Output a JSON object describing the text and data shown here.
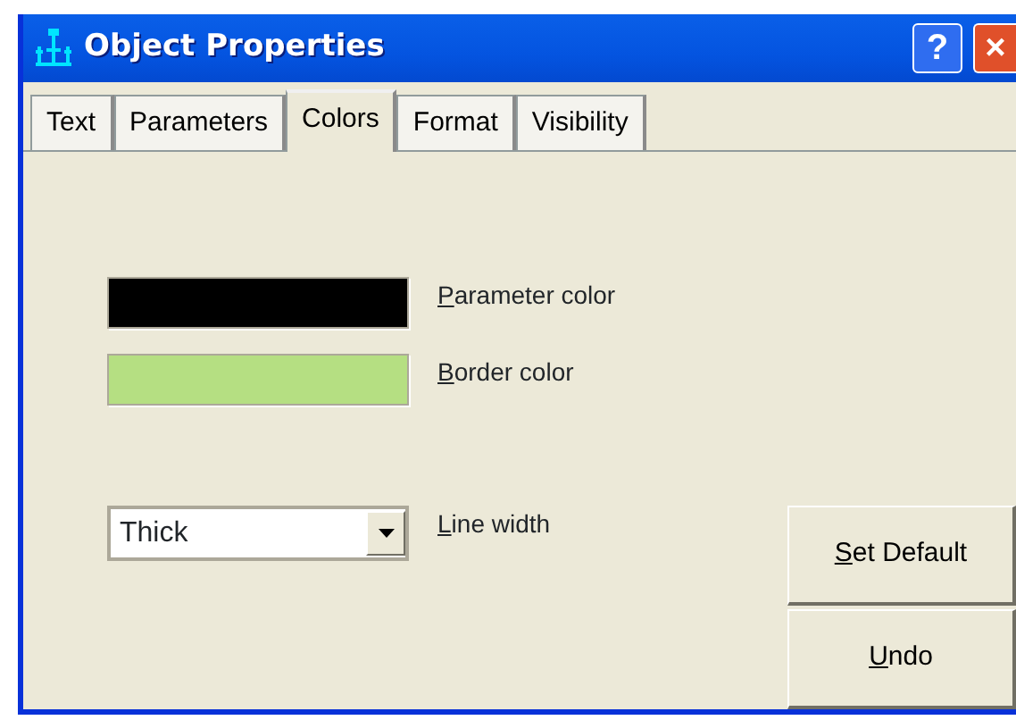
{
  "window": {
    "title": "Object Properties",
    "help_button": "?",
    "close_button": "×"
  },
  "tabs": [
    {
      "label": "Text",
      "selected": false
    },
    {
      "label": "Parameters",
      "selected": false
    },
    {
      "label": "Colors",
      "selected": true
    },
    {
      "label": "Format",
      "selected": false
    },
    {
      "label": "Visibility",
      "selected": false
    }
  ],
  "colors": [
    {
      "label": "Parameter color",
      "color": "#000000",
      "mnemonic_underlined": true
    },
    {
      "label": "Border color",
      "color": "#b5df82",
      "mnemonic_underlined": true
    }
  ],
  "line_width": {
    "label": "Line width",
    "value": "Thick",
    "mnemonic_underlined": true
  },
  "buttons": [
    {
      "label": "Set Default",
      "mnemonic_underlined": true
    },
    {
      "label": "Undo",
      "mnemonic_underlined": true
    }
  ]
}
